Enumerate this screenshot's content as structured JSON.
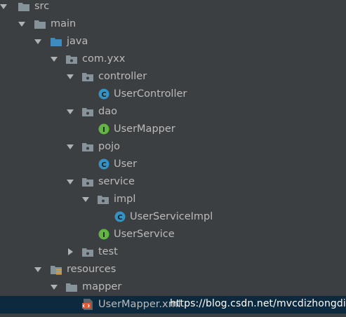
{
  "tree": {
    "rows": [
      {
        "label": "src",
        "icon": "folder-icon",
        "expanded": true
      },
      {
        "label": "main",
        "icon": "folder-icon",
        "expanded": true
      },
      {
        "label": "java",
        "icon": "source-folder-icon",
        "expanded": true
      },
      {
        "label": "com.yxx",
        "icon": "package-icon",
        "expanded": true
      },
      {
        "label": "controller",
        "icon": "package-icon",
        "expanded": true
      },
      {
        "label": "UserController",
        "icon": "class-icon"
      },
      {
        "label": "dao",
        "icon": "package-icon",
        "expanded": true
      },
      {
        "label": "UserMapper",
        "icon": "interface-icon"
      },
      {
        "label": "pojo",
        "icon": "package-icon",
        "expanded": true
      },
      {
        "label": "User",
        "icon": "class-icon"
      },
      {
        "label": "service",
        "icon": "package-icon",
        "expanded": true
      },
      {
        "label": "impl",
        "icon": "package-icon",
        "expanded": true
      },
      {
        "label": "UserServiceImpl",
        "icon": "class-icon"
      },
      {
        "label": "UserService",
        "icon": "interface-icon"
      },
      {
        "label": "test",
        "icon": "package-icon",
        "expanded": false
      },
      {
        "label": "resources",
        "icon": "resources-folder-icon",
        "expanded": true
      },
      {
        "label": "mapper",
        "icon": "folder-icon",
        "expanded": true
      },
      {
        "label": "UserMapper.xml",
        "icon": "xml-file-icon",
        "selected": true
      }
    ]
  },
  "watermark": "https://blog.csdn.net/mvcdizhongdi",
  "colors": {
    "background": "#3c3f41",
    "text": "#bbbbbb",
    "selection": "#0d293e",
    "folder": "#87939a",
    "source_folder": "#3d8bbf",
    "class": "#3592c4",
    "interface": "#62b543",
    "xml": "#e05a38"
  }
}
